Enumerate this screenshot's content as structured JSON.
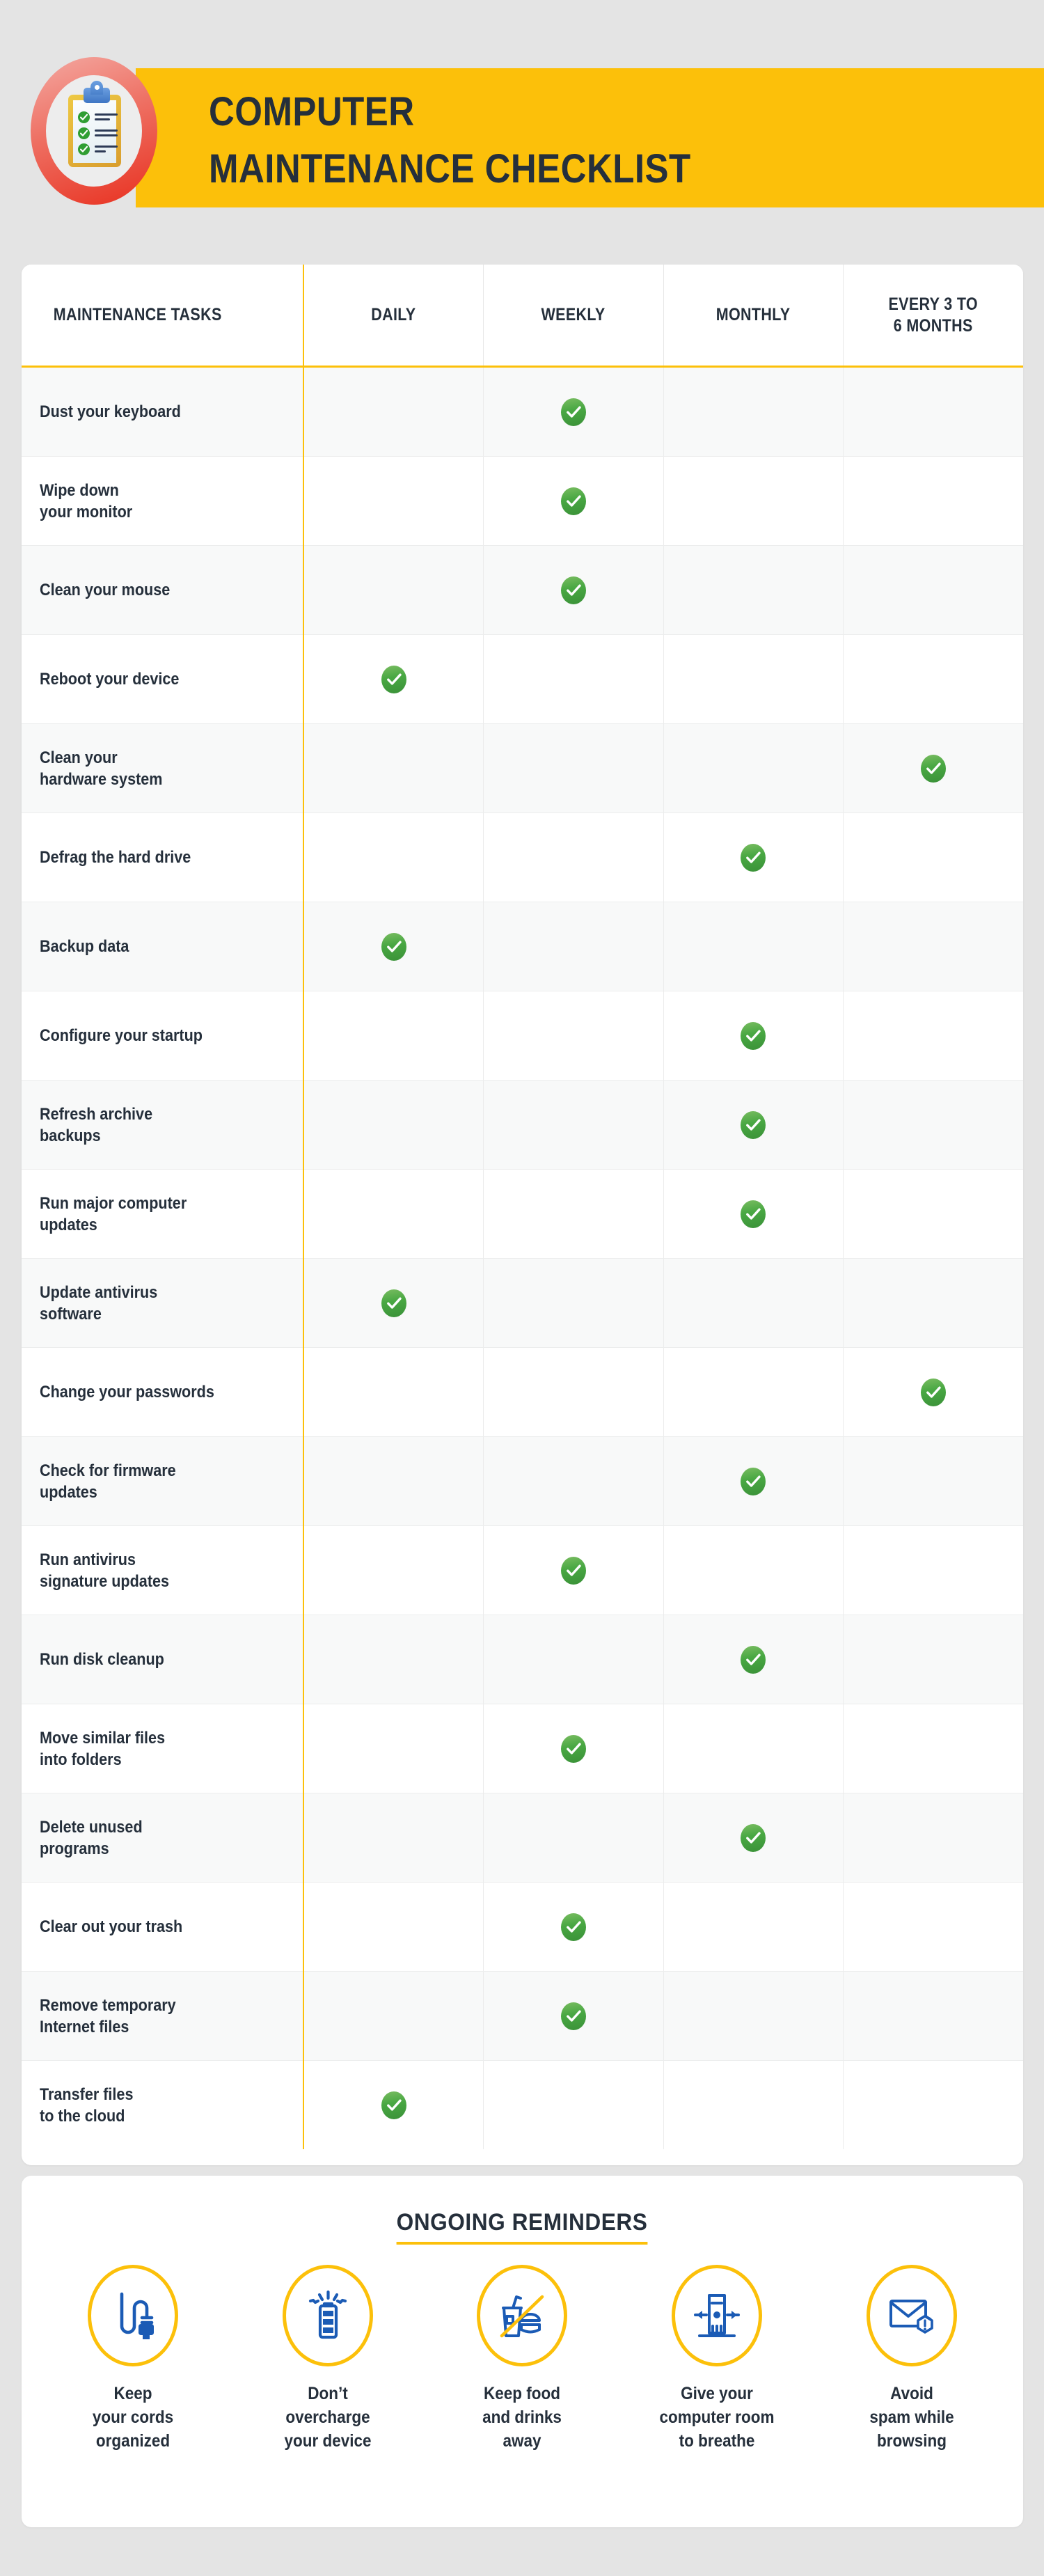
{
  "header": {
    "title_line1": "COMPUTER",
    "title_line2": "MAINTENANCE CHECKLIST",
    "badge_icon": "clipboard-checklist-icon",
    "bar_color": "#fcc00a",
    "title_color": "#252f3b",
    "ring_color": "#e8301f"
  },
  "table": {
    "columns": [
      {
        "key": "task",
        "label": "MAINTENANCE TASKS"
      },
      {
        "key": "daily",
        "label": "DAILY"
      },
      {
        "key": "weekly",
        "label": "WEEKLY"
      },
      {
        "key": "monthly",
        "label": "MONTHLY"
      },
      {
        "key": "every3to6",
        "label": "EVERY 3 TO\n6 MONTHS"
      }
    ],
    "check_color": "#49a843",
    "divider_color": "#fcc00a",
    "rows": [
      {
        "task": "Dust your keyboard",
        "daily": false,
        "weekly": true,
        "monthly": false,
        "every3to6": false
      },
      {
        "task": "Wipe down\nyour monitor",
        "daily": false,
        "weekly": true,
        "monthly": false,
        "every3to6": false
      },
      {
        "task": "Clean your mouse",
        "daily": false,
        "weekly": true,
        "monthly": false,
        "every3to6": false
      },
      {
        "task": "Reboot your device",
        "daily": true,
        "weekly": false,
        "monthly": false,
        "every3to6": false
      },
      {
        "task": "Clean your\nhardware system",
        "daily": false,
        "weekly": false,
        "monthly": false,
        "every3to6": true
      },
      {
        "task": "Defrag the hard drive",
        "daily": false,
        "weekly": false,
        "monthly": true,
        "every3to6": false
      },
      {
        "task": "Backup data",
        "daily": true,
        "weekly": false,
        "monthly": false,
        "every3to6": false
      },
      {
        "task": "Configure your startup",
        "daily": false,
        "weekly": false,
        "monthly": true,
        "every3to6": false
      },
      {
        "task": "Refresh archive\nbackups",
        "daily": false,
        "weekly": false,
        "monthly": true,
        "every3to6": false
      },
      {
        "task": "Run major computer\nupdates",
        "daily": false,
        "weekly": false,
        "monthly": true,
        "every3to6": false
      },
      {
        "task": "Update antivirus\nsoftware",
        "daily": true,
        "weekly": false,
        "monthly": false,
        "every3to6": false
      },
      {
        "task": "Change your passwords",
        "daily": false,
        "weekly": false,
        "monthly": false,
        "every3to6": true
      },
      {
        "task": "Check for firmware\nupdates",
        "daily": false,
        "weekly": false,
        "monthly": true,
        "every3to6": false
      },
      {
        "task": "Run antivirus\nsignature updates",
        "daily": false,
        "weekly": true,
        "monthly": false,
        "every3to6": false
      },
      {
        "task": "Run disk cleanup",
        "daily": false,
        "weekly": false,
        "monthly": true,
        "every3to6": false
      },
      {
        "task": "Move similar files\ninto folders",
        "daily": false,
        "weekly": true,
        "monthly": false,
        "every3to6": false
      },
      {
        "task": "Delete unused\nprograms",
        "daily": false,
        "weekly": false,
        "monthly": true,
        "every3to6": false
      },
      {
        "task": "Clear out your trash",
        "daily": false,
        "weekly": true,
        "monthly": false,
        "every3to6": false
      },
      {
        "task": "Remove temporary\nInternet files",
        "daily": false,
        "weekly": true,
        "monthly": false,
        "every3to6": false
      },
      {
        "task": "Transfer files\nto the cloud",
        "daily": true,
        "weekly": false,
        "monthly": false,
        "every3to6": false
      }
    ]
  },
  "reminders": {
    "title": "ONGOING REMINDERS",
    "accent_color": "#fcc00a",
    "icon_color": "#1b5bb5",
    "items": [
      {
        "icon": "power-cord-plug-icon",
        "label": "Keep\nyour cords\norganized"
      },
      {
        "icon": "battery-overcharge-icon",
        "label": "Don’t\novercharge\nyour device"
      },
      {
        "icon": "no-food-drinks-icon",
        "label": "Keep food\nand drinks\naway"
      },
      {
        "icon": "computer-airflow-icon",
        "label": "Give your\ncomputer room\nto breathe"
      },
      {
        "icon": "spam-email-warning-icon",
        "label": "Avoid\nspam while\nbrowsing"
      }
    ]
  }
}
